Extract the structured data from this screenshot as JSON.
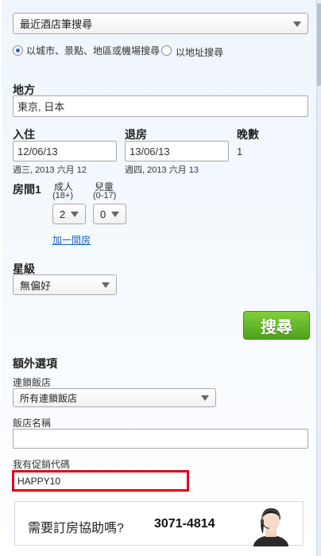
{
  "recent_search": {
    "value": "最近酒店筆搜尋"
  },
  "search_mode": {
    "option1": "以城市、景點、地區或機場搜尋",
    "option2": "以地址搜尋"
  },
  "destination": {
    "label": "地方",
    "value": "東京, 日本"
  },
  "checkin": {
    "label": "入住",
    "value": "12/06/13",
    "sub": "週三, 2013 六月 12"
  },
  "checkout": {
    "label": "退房",
    "value": "13/06/13",
    "sub": "週四, 2013 六月 13"
  },
  "nights": {
    "label": "晚數",
    "value": "1"
  },
  "room": {
    "label": "房間1",
    "adults_label": "成人",
    "adults_sub": "(18+)",
    "adults_value": "2",
    "children_label": "兒童",
    "children_sub": "(0-17)",
    "children_value": "0",
    "add_room": "加一間房"
  },
  "star": {
    "label": "星級",
    "value": "無偏好"
  },
  "search_button": "搜尋",
  "extra": {
    "title": "額外選項",
    "chain_label": "連鎖飯店",
    "chain_value": "所有連鎖飯店",
    "hotel_name_label": "飯店名稱",
    "hotel_name_value": "",
    "promo_label": "我有促銷代碼",
    "promo_value": "HAPPY10"
  },
  "help": {
    "question": "需要訂房協助嗎?",
    "phone": "3071-4814"
  }
}
